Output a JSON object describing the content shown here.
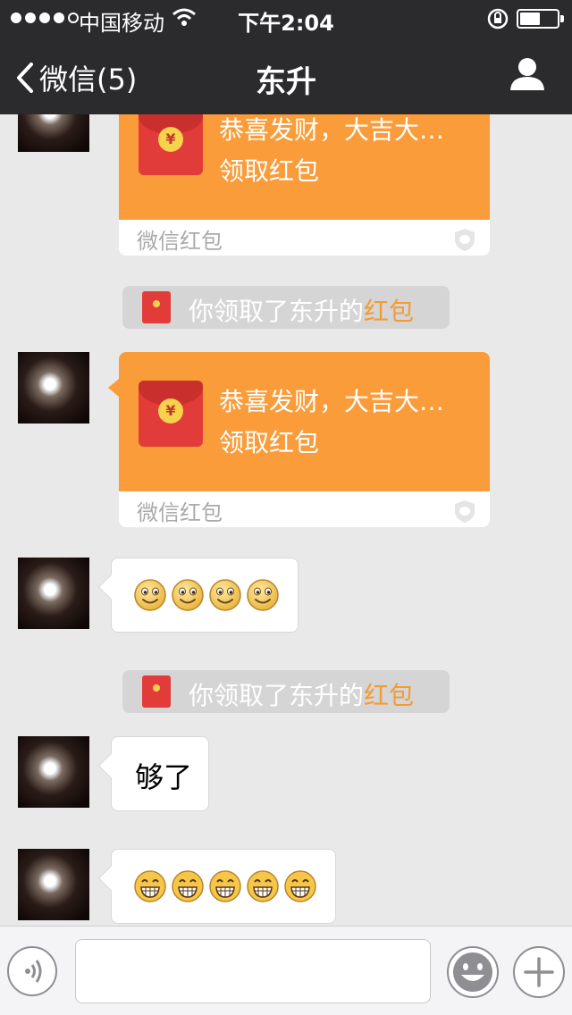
{
  "status_bar": {
    "carrier": "中国移动",
    "time": "下午2:04",
    "battery_level": 0.55
  },
  "nav": {
    "back_label": "微信(5)",
    "title": "东升"
  },
  "colors": {
    "red_packet_orange": "#fa9c3a",
    "envelope_red": "#e23c3a",
    "link_orange": "#f39b33",
    "nav_bg": "#2b2b2d",
    "chat_bg": "#e9e9e9"
  },
  "messages": {
    "rp1": {
      "greeting": "恭喜发财，大吉大…",
      "action": "领取红包",
      "footer": "微信红包",
      "badge_icon": "wechat-pay-shield-icon"
    },
    "sys1": {
      "text": "你领取了东升的",
      "link": "红包"
    },
    "rp2": {
      "greeting": "恭喜发财，大吉大…",
      "action": "领取红包",
      "footer": "微信红包",
      "badge_icon": "wechat-pay-shield-icon"
    },
    "emoji1": {
      "icon": "smile-emoji",
      "count": 4
    },
    "sys2": {
      "text": "你领取了东升的",
      "link": "红包"
    },
    "text1": {
      "text": "够了"
    },
    "emoji2": {
      "icon": "grin-emoji",
      "count": 5
    }
  },
  "input": {
    "value": "",
    "placeholder": "",
    "voice_icon": "voice-icon",
    "emoji_icon": "emoji-icon",
    "plus_icon": "plus-icon"
  }
}
